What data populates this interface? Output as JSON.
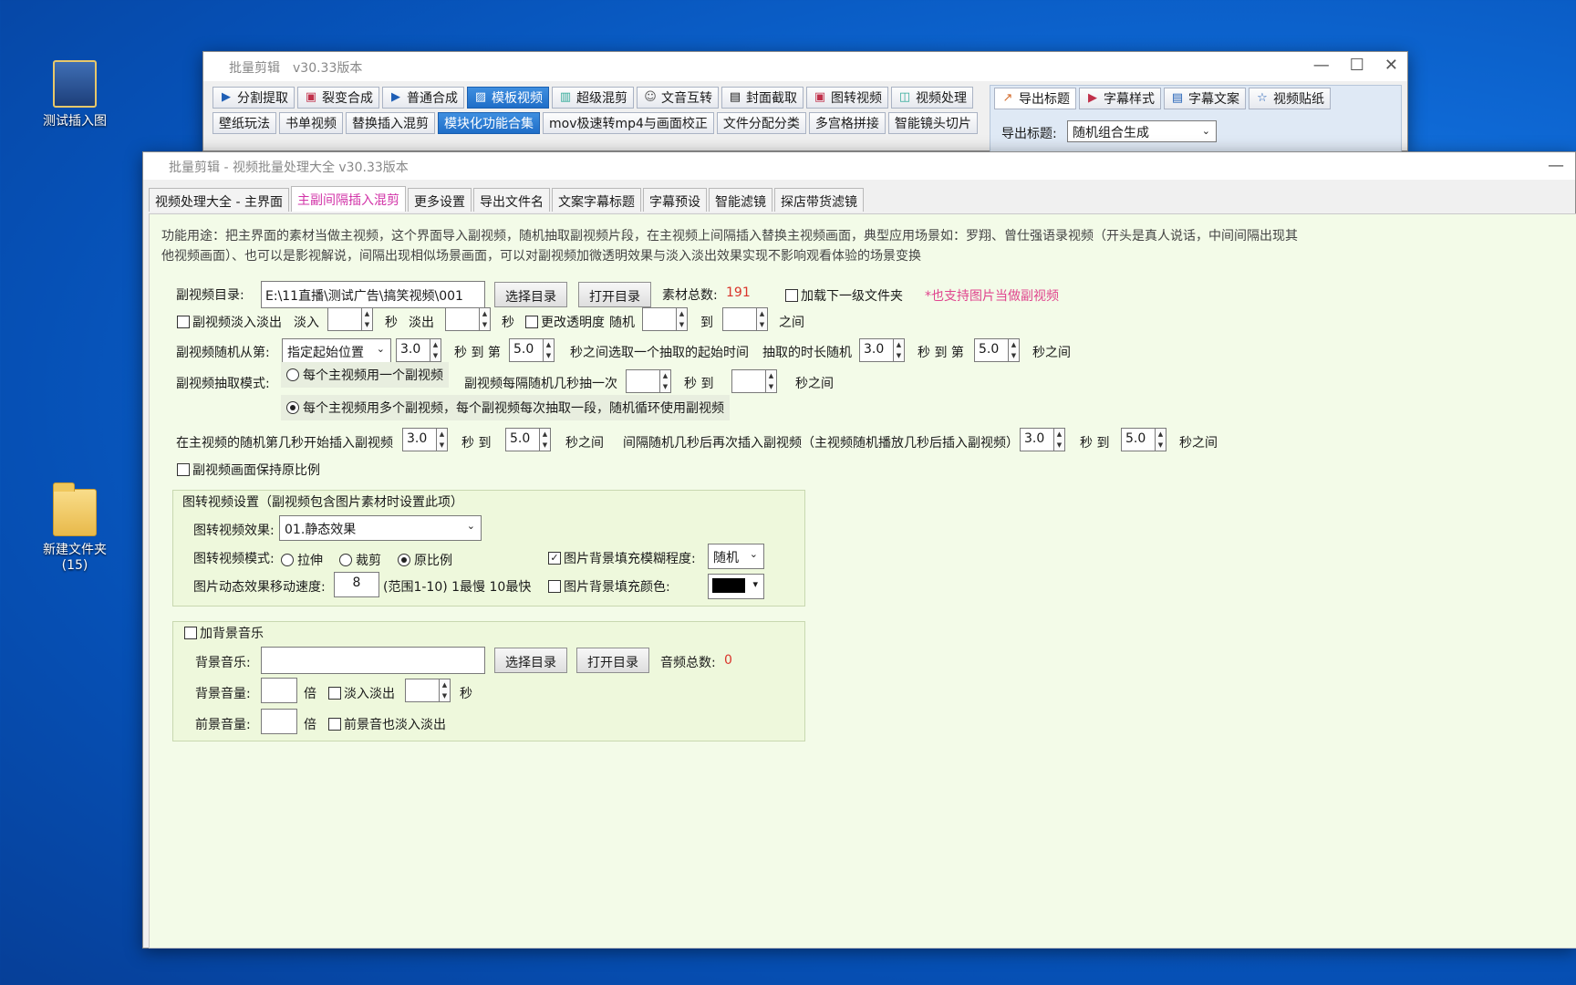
{
  "desktop": {
    "icon1_label": "测试插入图",
    "icon2_label": "新建文件夹",
    "icon2_count": "(15)"
  },
  "back_window": {
    "title": "批量剪辑　v30.33版本",
    "toolbar1": [
      "分割提取",
      "裂变合成",
      "普通合成",
      "模板视频",
      "超级混剪",
      "文音互转",
      "封面截取",
      "图转视频",
      "视频处理"
    ],
    "toolbar_right": [
      "导出标题",
      "字幕样式",
      "字幕文案",
      "视频贴纸"
    ],
    "toolbar2": [
      "壁纸玩法",
      "书单视频",
      "替换插入混剪",
      "模块化功能合集",
      "mov极速转mp4与画面校正",
      "文件分配分类",
      "多宫格拼接",
      "智能镜头切片"
    ],
    "export_title_label": "导出标题:",
    "export_title_value": "随机组合生成"
  },
  "front_window": {
    "title": "批量剪辑 -  视频批量处理大全  v30.33版本",
    "tabs": [
      "视频处理大全 - 主界面",
      "主副间隔插入混剪",
      "更多设置",
      "导出文件名",
      "文案字幕标题",
      "字幕预设",
      "智能滤镜",
      "探店带货滤镜"
    ],
    "desc_line1": "功能用途：把主界面的素材当做主视频，这个界面导入副视频，随机抽取副视频片段，在主视频上间隔插入替换主视频画面，典型应用场景如：罗翔、曾仕强语录视频（开头是真人说话，中间间隔出现其",
    "desc_line2": "他视频画面）、也可以是影视解说，间隔出现相似场景画面，可以对副视频加微透明效果与淡入淡出效果实现不影响观看体验的场景变换",
    "sub_dir_label": "副视频目录:",
    "sub_dir_value": "E:\\11直播\\测试广告\\搞笑视频\\001",
    "choose_dir": "选择目录",
    "open_dir": "打开目录",
    "material_count_label": "素材总数:",
    "material_count": "191",
    "load_sub_folder": "加载下一级文件夹",
    "support_note": "*也支持图片当做副视频",
    "fade_label": "副视频淡入淡出",
    "fade_in": "淡入",
    "sec": "秒",
    "fade_out": "淡出",
    "change_opacity": "更改透明度",
    "random": "随机",
    "to": "到",
    "between": "之间",
    "random_from_label": "副视频随机从第:",
    "start_pos": "指定起始位置",
    "v_3": "3.0",
    "v_5": "5.0",
    "sec_to_nth": "秒 到 第",
    "sec_select_start": "秒之间选取一个抽取的起始时间",
    "duration_random": "抽取的时长随机",
    "sec_between": "秒之间",
    "extract_mode_label": "副视频抽取模式:",
    "mode1": "每个主视频用一个副视频",
    "every_random": "副视频每隔随机几秒抽一次",
    "sec_to": "秒 到",
    "mode2": "每个主视频用多个副视频，每个副视频每次抽取一段，随机循环使用副视频",
    "insert_start_label": "在主视频的随机第几秒开始插入副视频",
    "interval_label": "间隔随机几秒后再次插入副视频（主视频随机播放几秒后插入副视频）",
    "keep_ratio": "副视频画面保持原比例",
    "img_group_title": "图转视频设置（副视频包含图片素材时设置此项）",
    "img_effect_label": "图转视频效果:",
    "img_effect_value": "01.静态效果",
    "img_mode_label": "图转视频模式:",
    "stretch": "拉伸",
    "crop": "裁剪",
    "original": "原比例",
    "bg_blur_label": "图片背景填充模糊程度:",
    "bg_blur_value": "随机",
    "move_speed_label": "图片动态效果移动速度:",
    "move_speed": "8",
    "range_note": "(范围1-10)  1最慢  10最快",
    "bg_color_label": "图片背景填充颜色:",
    "bgm_title": "加背景音乐",
    "bgm_label": "背景音乐:",
    "audio_count_label": "音频总数:",
    "audio_count": "0",
    "bg_volume_label": "背景音量:",
    "times": "倍",
    "fade_inout": "淡入淡出",
    "fg_volume_label": "前景音量:",
    "fg_fade": "前景音也淡入淡出"
  }
}
